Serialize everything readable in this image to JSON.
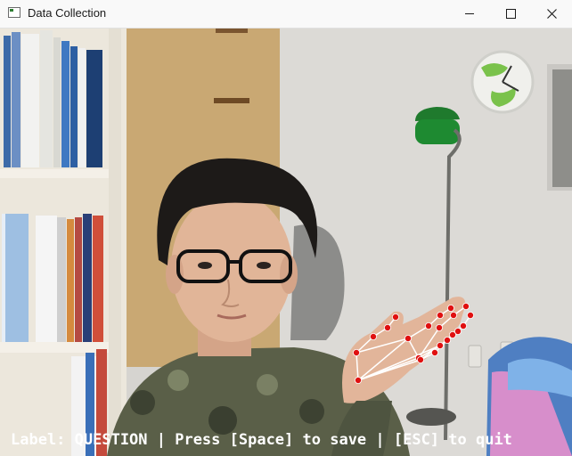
{
  "window": {
    "title": "Data Collection",
    "controls": {
      "minimize": "minimize-icon",
      "maximize": "maximize-icon",
      "close": "close-icon"
    }
  },
  "camera": {
    "overlay_text": "Label: QUESTION | Press [Space] to save | [ESC] to quit",
    "overlay_color": "#ffffff",
    "landmark_color": "#e01010",
    "connection_color": "#ffffff"
  }
}
